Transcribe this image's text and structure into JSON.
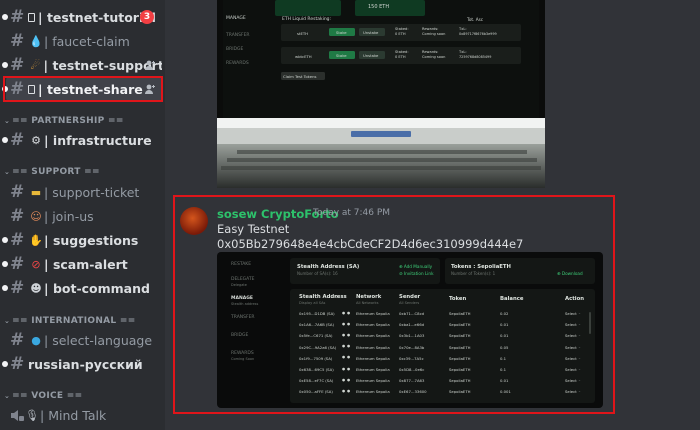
{
  "sidebar": {
    "channels_top": [
      {
        "name": "testnet-tutorial",
        "badge": "3",
        "prefix": "|"
      },
      {
        "name": "faucet-claim",
        "prefix": "|"
      },
      {
        "name": "testnet-support",
        "prefix": "|"
      },
      {
        "name": "testnet-share",
        "prefix": "|"
      }
    ],
    "cat_partnership": "== PARTNERSHIP ==",
    "infrastructure": "infrastructure",
    "cat_support": "== SUPPORT ==",
    "support_channels": [
      {
        "name": "support-ticket",
        "prefix": "|"
      },
      {
        "name": "join-us",
        "prefix": "|"
      },
      {
        "name": "suggestions",
        "prefix": "|"
      },
      {
        "name": "scam-alert",
        "prefix": "|"
      },
      {
        "name": "bot-command",
        "prefix": "|"
      }
    ],
    "cat_international": "== INTERNATIONAL ==",
    "intl_channels": [
      {
        "name": "select-language",
        "prefix": "|"
      },
      {
        "name": "russian-русский"
      }
    ],
    "cat_voice": "== VOICE ==",
    "voice_channels": [
      {
        "name": "Mind Talk",
        "prefix": "|"
      }
    ]
  },
  "photo": {
    "nav": [
      "MANAGE",
      "TRANSFER",
      "BRIDGE",
      "REWARDS"
    ],
    "eth_amount": "150 ETH",
    "restaking_title": "ETH Liquid Restaking:",
    "sort": "Tot. Asc",
    "rows": [
      {
        "asset": "stETH",
        "stake": "Stake",
        "unstake": "Unstake",
        "staked_label": "Staked:",
        "staked": "0 ETH",
        "rewards_label": "Rewards:",
        "rewards": "Coming soon",
        "id_label": "TxL:",
        "id": "0x89717f8676b3e999"
      },
      {
        "asset": "wbtcETH",
        "stake": "Stake",
        "unstake": "Unstake",
        "staked_label": "Staked:",
        "staked": "0 ETH",
        "rewards_label": "Rewards:",
        "rewards": "Coming soon",
        "id_label": "TxL:",
        "id": "7259768d8085499"
      }
    ],
    "claim_btn": "Claim Test Tokens"
  },
  "message": {
    "author": "sosew CryptoForto",
    "timestamp": "Today at 7:46 PM",
    "line1": "Easy Testnet",
    "line2": "0x05Bb279648e4e4cbCdeCF2D4d6ec310999d444e7"
  },
  "dashboard": {
    "nav": [
      {
        "label": "RESTAKE",
        "sub": ""
      },
      {
        "label": "DELEGATE",
        "sub": "Delegate"
      },
      {
        "label": "MANAGE",
        "sub": "Stealth address"
      },
      {
        "label": "TRANSFER",
        "sub": ""
      },
      {
        "label": "BRIDGE",
        "sub": ""
      },
      {
        "label": "REWARDS",
        "sub": "Coming Soon"
      }
    ],
    "stealth_title": "Stealth Address (SA)",
    "stealth_sub": "Number of SA(s): 16",
    "add_manually": "Add Manually",
    "invitation_link": "Invitation Link",
    "tokens_title": "Tokens : SepoliaETH",
    "tokens_sub": "Number of Token(s): 1",
    "download": "Download",
    "columns": [
      "Stealth Address",
      "Network",
      "Sender",
      "Token",
      "Balance",
      "Action"
    ],
    "col_subs": [
      "Display all SAs",
      "All Networks",
      "All Senders"
    ],
    "rows": [
      {
        "addr": "0x195...D1DB (SA)",
        "network": "Ethereum Sepolia",
        "sender": "0xb71...C8cd",
        "token": "SepoliaETH",
        "balance": "0.02",
        "action": "Select"
      },
      {
        "addr": "0x1A6...7A6B (SA)",
        "network": "Ethereum Sepolia",
        "sender": "0xba1...e66d",
        "token": "SepoliaETH",
        "balance": "0.01",
        "action": "Select"
      },
      {
        "addr": "0x5fe...C671 (SA)",
        "network": "Ethereum Sepolia",
        "sender": "0x3b1...1A03",
        "token": "SepoliaETH",
        "balance": "0.01",
        "action": "Select"
      },
      {
        "addr": "0x29C...9A2a6 (SA)",
        "network": "Ethereum Sepolia",
        "sender": "0x70e...8A3b",
        "token": "SepoliaETH",
        "balance": "0.05",
        "action": "Select"
      },
      {
        "addr": "0x1f9...7509 (SA)",
        "network": "Ethereum Sepolia",
        "sender": "0xc39...7A5c",
        "token": "SepoliaETH",
        "balance": "0.1",
        "action": "Select"
      },
      {
        "addr": "0x638...69C5 (SA)",
        "network": "Ethereum Sepolia",
        "sender": "0x5D8...0e6c",
        "token": "SepoliaETH",
        "balance": "0.1",
        "action": "Select"
      },
      {
        "addr": "0xE58...eF7C (SA)",
        "network": "Ethereum Sepolia",
        "sender": "0x877...7A63",
        "token": "SepoliaETH",
        "balance": "0.01",
        "action": "Select"
      },
      {
        "addr": "0x050...aFFE (SA)",
        "network": "Ethereum Sepolia",
        "sender": "0xE67...33600",
        "token": "SepoliaETH",
        "balance": "0.001",
        "action": "Select"
      }
    ]
  },
  "colors": {
    "highlight": "#e0151a",
    "author": "#2dc26b",
    "badge": "#f23f43"
  }
}
